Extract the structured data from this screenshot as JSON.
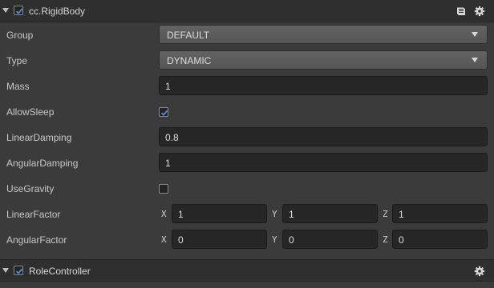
{
  "rigidbody": {
    "title": "cc.RigidBody",
    "enabled": true,
    "icons": [
      "help-book-icon",
      "gear-icon"
    ],
    "fields": {
      "group": {
        "label": "Group",
        "value": "DEFAULT"
      },
      "type": {
        "label": "Type",
        "value": "DYNAMIC"
      },
      "mass": {
        "label": "Mass",
        "value": "1"
      },
      "allow_sleep": {
        "label": "AllowSleep",
        "checked": true
      },
      "linear_damping": {
        "label": "LinearDamping",
        "value": "0.8"
      },
      "angular_damping": {
        "label": "AngularDamping",
        "value": "1"
      },
      "use_gravity": {
        "label": "UseGravity",
        "checked": false
      },
      "linear_factor": {
        "label": "LinearFactor",
        "x_label": "X",
        "y_label": "Y",
        "z_label": "Z",
        "x": "1",
        "y": "1",
        "z": "1"
      },
      "angular_factor": {
        "label": "AngularFactor",
        "x_label": "X",
        "y_label": "Y",
        "z_label": "Z",
        "x": "0",
        "y": "0",
        "z": "0"
      }
    }
  },
  "role_controller": {
    "title": "RoleController",
    "enabled": true,
    "icons": [
      "gear-icon"
    ]
  },
  "colors": {
    "panel_bg": "#3b3b3b",
    "header_bg": "#2f2f2f",
    "input_bg": "#262626",
    "select_bg": "#5a5a5a",
    "check_accent": "#4a90e2"
  }
}
